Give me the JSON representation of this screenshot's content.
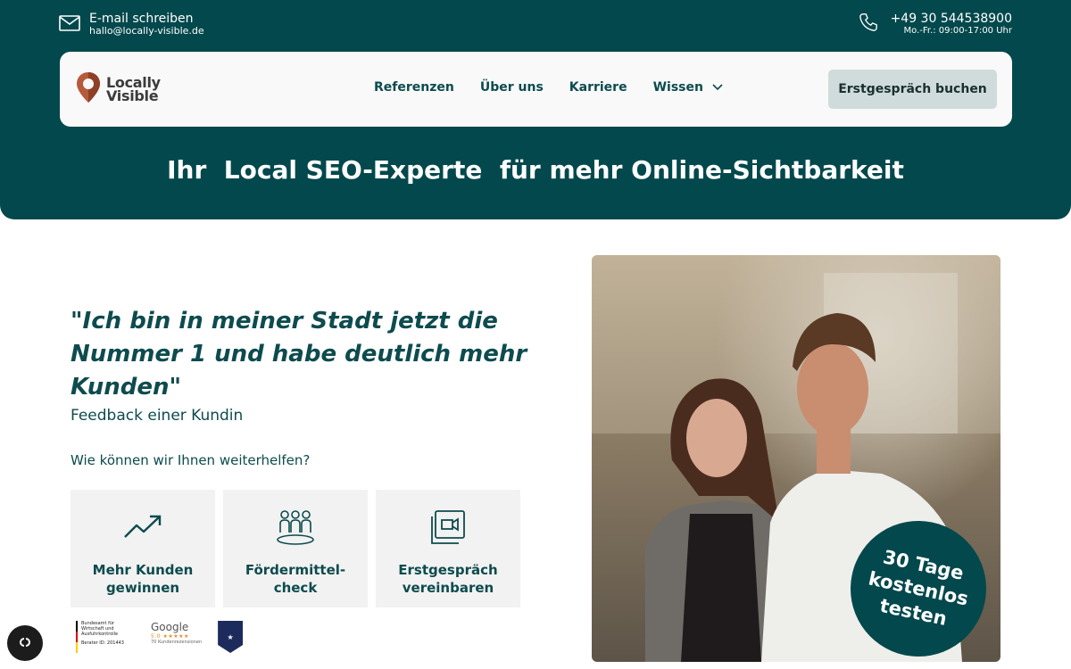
{
  "topbar": {
    "email_label": "E-mail schreiben",
    "email_address": "hallo@locally-visible.de",
    "phone_number": "+49 30 544538900",
    "phone_hours": "Mo.-Fr.: 09:00-17:00 Uhr"
  },
  "brand": {
    "line1": "Locally",
    "line2": "Visible",
    "accent": "#b65a3c"
  },
  "nav": {
    "items": [
      "Referenzen",
      "Über uns",
      "Karriere"
    ],
    "dropdown_label": "Wissen",
    "cta_label": "Erstgespräch buchen"
  },
  "hero": {
    "headline": "Ihr  Local SEO-Experte  für mehr Online-Sichtbarkeit"
  },
  "testimonial": {
    "quote": "\"Ich bin in meiner Stadt jetzt die Nummer 1 und habe deutlich mehr Kunden\"",
    "source": "Feedback einer Kundin"
  },
  "help": {
    "question": "Wie können wir Ihnen weiterhelfen?",
    "tiles": [
      {
        "label": "Mehr Kunden\ngewinnen",
        "icon": "trend-up-icon"
      },
      {
        "label": "Fördermittel-\ncheck",
        "icon": "group-icon"
      },
      {
        "label": "Erstgespräch\nvereinbaren",
        "icon": "video-call-icon"
      }
    ]
  },
  "badges": {
    "bund_text": "Bundesamt für Wirtschaft und Ausfuhrkontrolle",
    "bund_id": "Berater ID: 201443",
    "google_label": "Google",
    "google_rating": "5.0 ★★★★★",
    "google_reviews": "70 Kundenrezensionen"
  },
  "promo": {
    "text": "30 Tage\nkostenlos\ntesten"
  },
  "colors": {
    "primary": "#03484c",
    "cta_bg": "#cfdcdb",
    "tile_bg": "#f2f2f2"
  }
}
